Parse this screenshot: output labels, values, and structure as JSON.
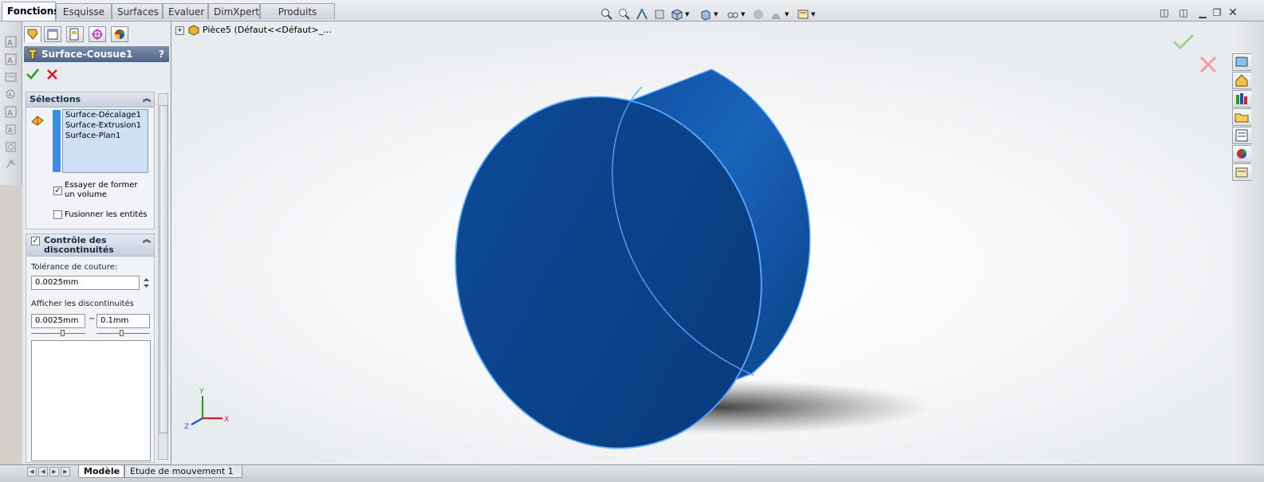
{
  "tabs": [
    {
      "label": "Fonctions",
      "active": true
    },
    {
      "label": "Esquisse"
    },
    {
      "label": "Surfaces"
    },
    {
      "label": "Evaluer"
    },
    {
      "label": "DimXpert"
    },
    {
      "label": "Produits Office"
    }
  ],
  "property_manager": {
    "title": "Surface-Cousue1",
    "help": "?",
    "selections": {
      "header": "Sélections",
      "items": [
        "Surface-Décalage1",
        "Surface-Extrusion1",
        "Surface-Plan1"
      ],
      "try_volume_label_1": "Essayer de former",
      "try_volume_label_2": "un volume",
      "try_volume_checked": "✓",
      "merge_label": "Fusionner les entités"
    },
    "gap_control": {
      "header_1": "Contrôle des",
      "header_2": "discontinuités",
      "checked": "✓",
      "tolerance_label": "Tolérance de couture:",
      "tolerance_value": "0.0025mm",
      "show_gaps_label": "Afficher les discontinuités",
      "gap_min": "0.0025mm",
      "gap_separator": "~",
      "gap_max": "0.1mm"
    }
  },
  "viewport": {
    "tree_root": "Pièce5  (Défaut<<Défaut>_...",
    "triad": {
      "x": "X",
      "y": "Y",
      "z": "Z"
    }
  },
  "bottom_tabs": [
    {
      "label": "Modèle",
      "active": true
    },
    {
      "label": "Etude de mouvement 1"
    }
  ],
  "colors": {
    "body_blue": "#0d4fa0",
    "edge_blue": "#5aa8ff",
    "accept_green": "#2e9e1e",
    "cancel_red": "#d42020"
  }
}
